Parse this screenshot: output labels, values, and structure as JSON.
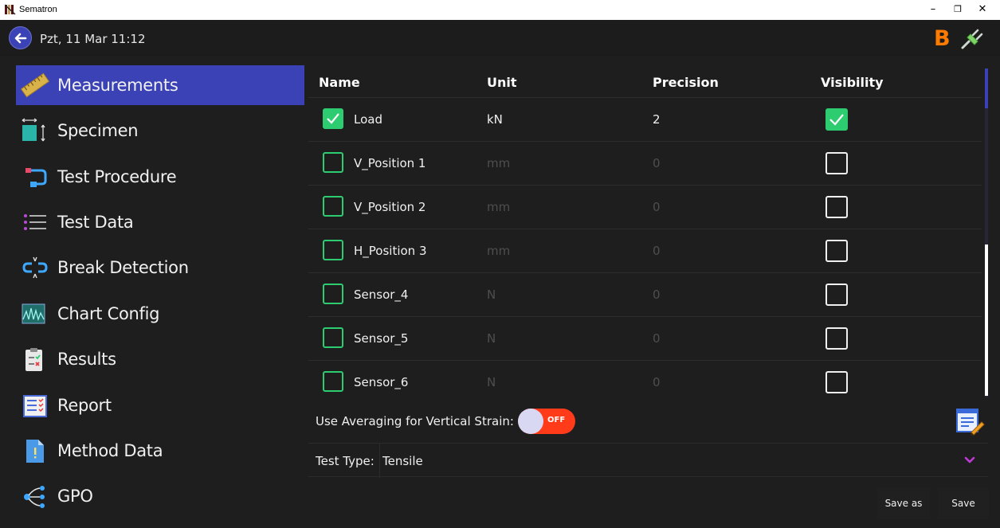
{
  "window": {
    "title": "Sematron",
    "controls": {
      "minimize": "–",
      "restore": "❐",
      "close": "✕"
    }
  },
  "header": {
    "datetime": "Pzt, 11 Mar  11:12",
    "status_letter": "B"
  },
  "sidebar": {
    "items": [
      {
        "label": "Measurements",
        "icon": "ruler-icon",
        "active": true
      },
      {
        "label": "Specimen",
        "icon": "specimen-icon",
        "active": false
      },
      {
        "label": "Test Procedure",
        "icon": "procedure-icon",
        "active": false
      },
      {
        "label": "Test Data",
        "icon": "list-icon",
        "active": false
      },
      {
        "label": "Break Detection",
        "icon": "break-link-icon",
        "active": false
      },
      {
        "label": "Chart Config",
        "icon": "chart-icon",
        "active": false
      },
      {
        "label": "Results",
        "icon": "clipboard-icon",
        "active": false
      },
      {
        "label": "Report",
        "icon": "report-icon",
        "active": false
      },
      {
        "label": "Method Data",
        "icon": "document-icon",
        "active": false
      },
      {
        "label": "GPO",
        "icon": "gpo-icon",
        "active": false
      }
    ]
  },
  "table": {
    "headers": {
      "name": "Name",
      "unit": "Unit",
      "precision": "Precision",
      "visibility": "Visibility"
    },
    "rows": [
      {
        "name": "Load",
        "unit": "kN",
        "precision": "2",
        "enabled": true,
        "visible": true
      },
      {
        "name": "V_Position 1",
        "unit": "mm",
        "precision": "0",
        "enabled": false,
        "visible": false
      },
      {
        "name": "V_Position 2",
        "unit": "mm",
        "precision": "0",
        "enabled": false,
        "visible": false
      },
      {
        "name": "H_Position 3",
        "unit": "mm",
        "precision": "0",
        "enabled": false,
        "visible": false
      },
      {
        "name": "Sensor_4",
        "unit": "N",
        "precision": "0",
        "enabled": false,
        "visible": false
      },
      {
        "name": "Sensor_5",
        "unit": "N",
        "precision": "0",
        "enabled": false,
        "visible": false
      },
      {
        "name": "Sensor_6",
        "unit": "N",
        "precision": "0",
        "enabled": false,
        "visible": false
      }
    ]
  },
  "averaging": {
    "label": "Use Averaging for Vertical Strain:",
    "state": "OFF"
  },
  "test_type": {
    "label": "Test Type:",
    "value": "Tensile"
  },
  "buttons": {
    "save_as": "Save as",
    "save": "Save"
  },
  "colors": {
    "accent": "#3b42b5",
    "check_green": "#2ecc71",
    "toggle_off": "#ff3b1a",
    "status_orange": "#ff7a00"
  }
}
